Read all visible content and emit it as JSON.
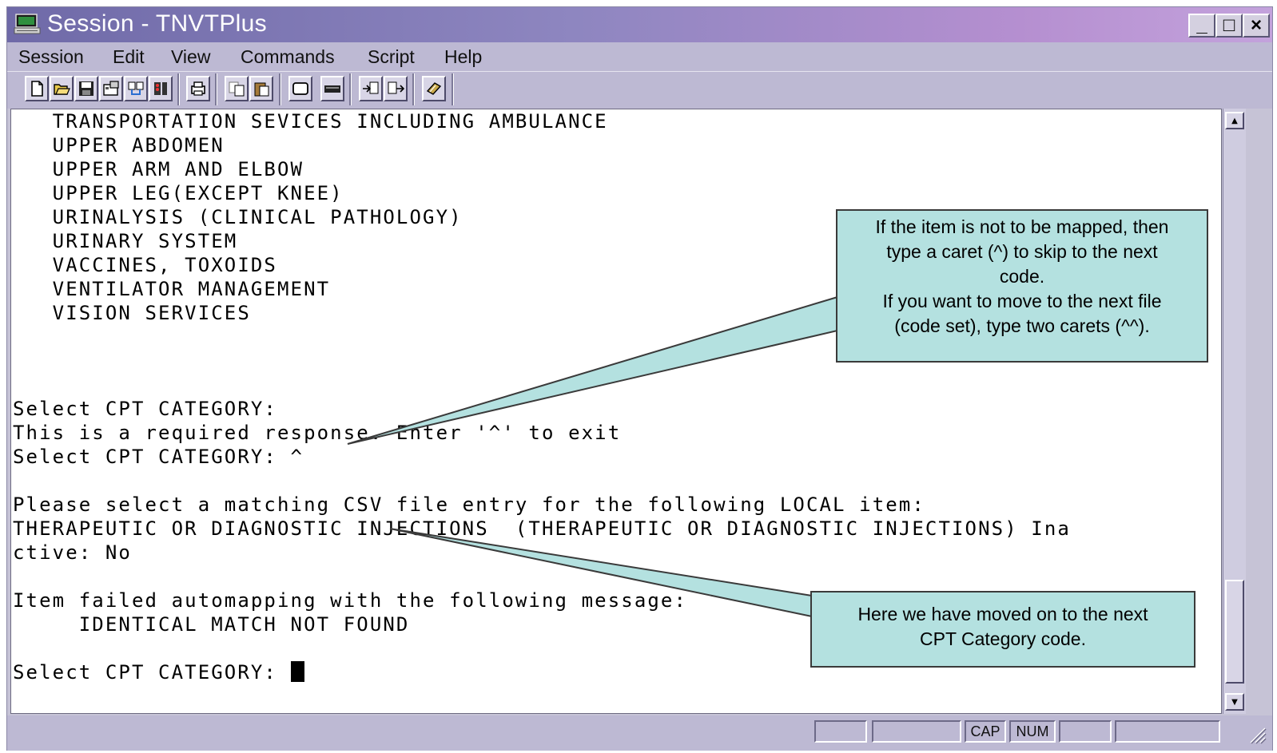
{
  "window": {
    "title": "Session - TNVTPlus",
    "minimize": "_",
    "maximize": "□",
    "close": "×"
  },
  "menu": [
    "Session",
    "Edit",
    "View",
    "Commands",
    "Script",
    "Help"
  ],
  "toolbar": {
    "icons": [
      "new-session-icon",
      "open-icon",
      "save-icon",
      "properties-icon",
      "connect-icon",
      "disconnect-icon",
      "print-icon",
      "copy-icon",
      "paste-icon",
      "clear-screen-icon",
      "keyboard-icon",
      "send-file-icon",
      "receive-file-icon",
      "script-icon"
    ]
  },
  "terminal": {
    "lines": [
      "   TRANSPORTATION SEVICES INCLUDING AMBULANCE",
      "   UPPER ABDOMEN",
      "   UPPER ARM AND ELBOW",
      "   UPPER LEG(EXCEPT KNEE)",
      "   URINALYSIS (CLINICAL PATHOLOGY)",
      "   URINARY SYSTEM",
      "   VACCINES, TOXOIDS",
      "   VENTILATOR MANAGEMENT",
      "   VISION SERVICES",
      "",
      "",
      "",
      "Select CPT CATEGORY:",
      "This is a required response. Enter '^' to exit",
      "Select CPT CATEGORY: ^",
      "",
      "Please select a matching CSV file entry for the following LOCAL item:",
      "THERAPEUTIC OR DIAGNOSTIC INJECTIONS  (THERAPEUTIC OR DIAGNOSTIC INJECTIONS) Ina",
      "ctive: No",
      "",
      "Item failed automapping with the following message:",
      "     IDENTICAL MATCH NOT FOUND",
      "",
      "Select CPT CATEGORY: "
    ]
  },
  "callouts": {
    "caret_help": {
      "lines": [
        "If the item is not to be mapped, then",
        "type a caret (^) to skip to the next",
        "code.",
        "If you want to move to the next file",
        "(code set), type two carets (^^)."
      ]
    },
    "next_code": {
      "lines": [
        "Here we have moved on to the next",
        "CPT Category code."
      ]
    }
  },
  "statusbar": {
    "cap": "CAP",
    "num": "NUM"
  }
}
